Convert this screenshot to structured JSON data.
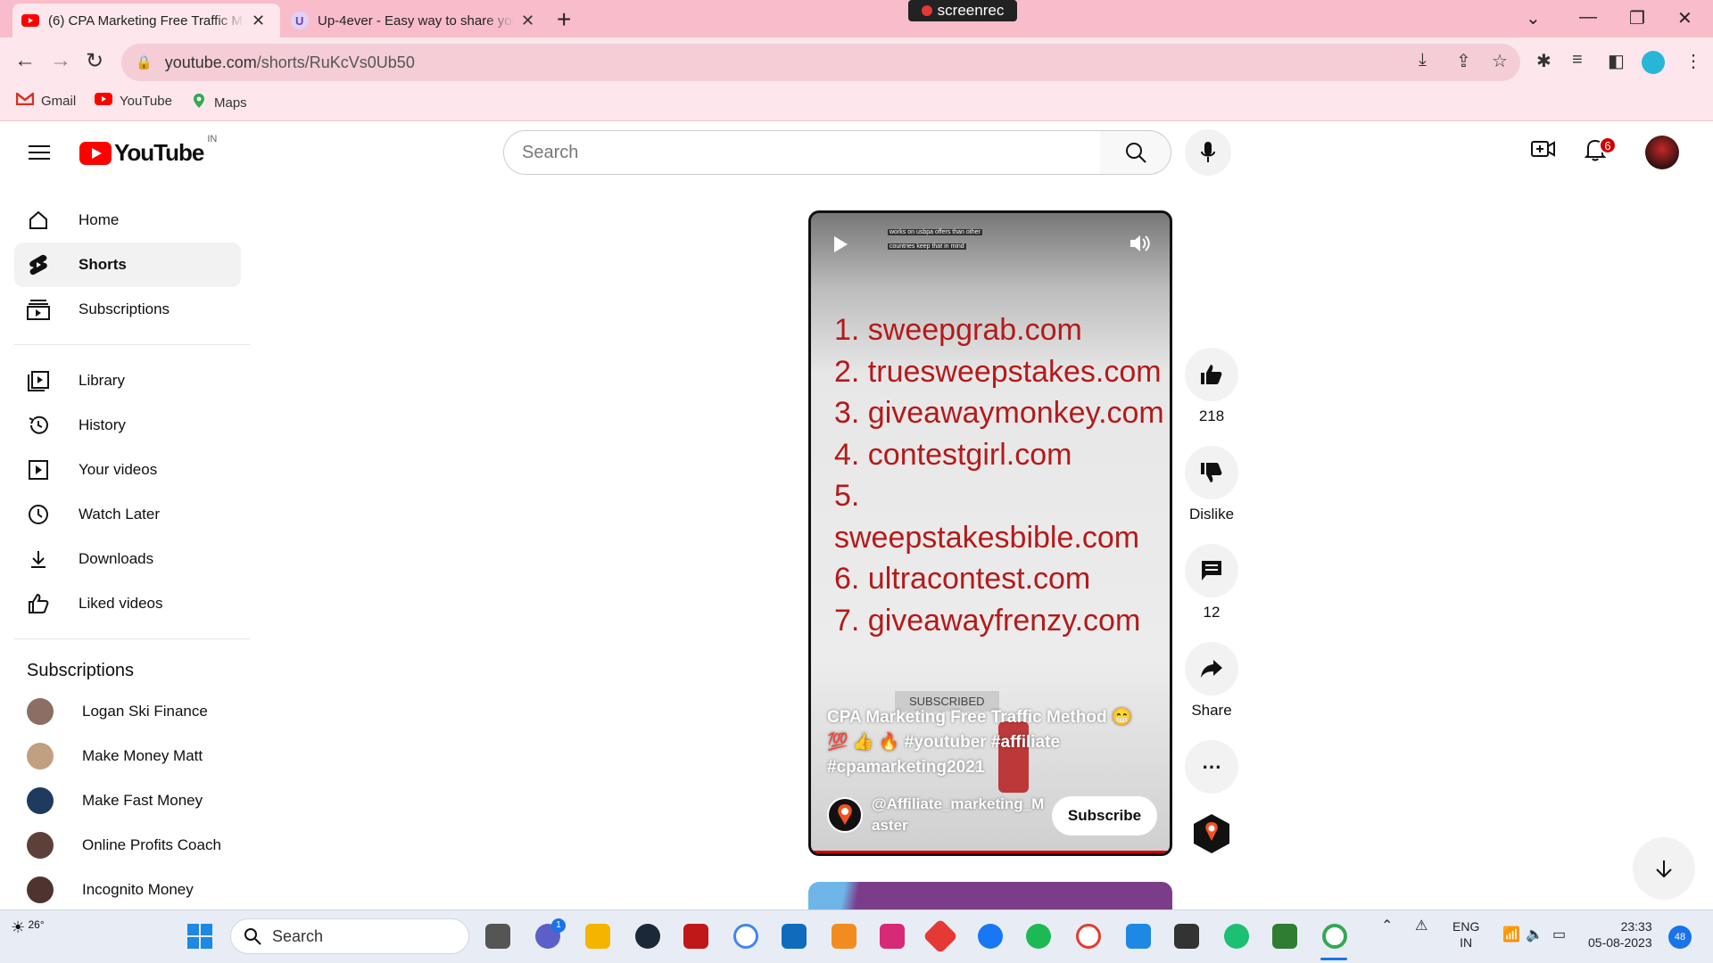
{
  "browser": {
    "tabs": [
      {
        "title": "(6) CPA Marketing Free Traffic Method",
        "active": true
      },
      {
        "title": "Up-4ever - Easy way to share your files",
        "active": false
      }
    ],
    "recorder_label": "screenrec",
    "url_host": "youtube.com",
    "url_path": "/shorts/RuKcVs0Ub50",
    "bookmarks": [
      "Gmail",
      "YouTube",
      "Maps"
    ]
  },
  "header": {
    "logo_text": "YouTube",
    "country_code": "IN",
    "search_placeholder": "Search",
    "notifications_count": "6"
  },
  "sidebar": {
    "main": [
      {
        "label": "Home",
        "icon": "home-icon"
      },
      {
        "label": "Shorts",
        "icon": "shorts-icon",
        "active": true
      },
      {
        "label": "Subscriptions",
        "icon": "subscriptions-icon"
      }
    ],
    "library": [
      {
        "label": "Library",
        "icon": "library-icon"
      },
      {
        "label": "History",
        "icon": "history-icon"
      },
      {
        "label": "Your videos",
        "icon": "your-videos-icon"
      },
      {
        "label": "Watch Later",
        "icon": "watch-later-icon"
      },
      {
        "label": "Downloads",
        "icon": "download-icon"
      },
      {
        "label": "Liked videos",
        "icon": "like-icon"
      }
    ],
    "subscriptions_heading": "Subscriptions",
    "subscriptions": [
      {
        "label": "Logan Ski Finance",
        "color": "#8d6e63"
      },
      {
        "label": "Make Money Matt",
        "color": "#c0a080"
      },
      {
        "label": "Make Fast Money",
        "color": "#1e3a5f"
      },
      {
        "label": "Online Profits Coach",
        "color": "#5d4037"
      },
      {
        "label": "Incognito Money",
        "color": "#4e342e"
      }
    ]
  },
  "short": {
    "caption_line1": "works on usbpa offers than other",
    "caption_line2": "countries keep that in mind",
    "sites": [
      "1. sweepgrab.com",
      "2. truesweepstakes.com",
      "3. giveawaymonkey.com",
      "4. contestgirl.com",
      "5. sweepstakesbible.com",
      "6. ultracontest.com",
      "7. giveawayfrenzy.com"
    ],
    "overlay_subscribed": "SUBSCRIBED",
    "title": "CPA Marketing Free Traffic Method 😁 💯 👍 🔥 #youtuber #affiliate #cpamarketing2021",
    "channel": "@Affiliate_marketing_Master",
    "subscribe_label": "Subscribe"
  },
  "actions": {
    "likes": "218",
    "dislike_label": "Dislike",
    "comments": "12",
    "share_label": "Share"
  },
  "taskbar": {
    "temperature": "26°",
    "search_placeholder": "Search",
    "teams_badge": "1",
    "lang_top": "ENG",
    "lang_bottom": "IN",
    "time": "23:33",
    "date": "05-08-2023",
    "notif_count": "48"
  }
}
